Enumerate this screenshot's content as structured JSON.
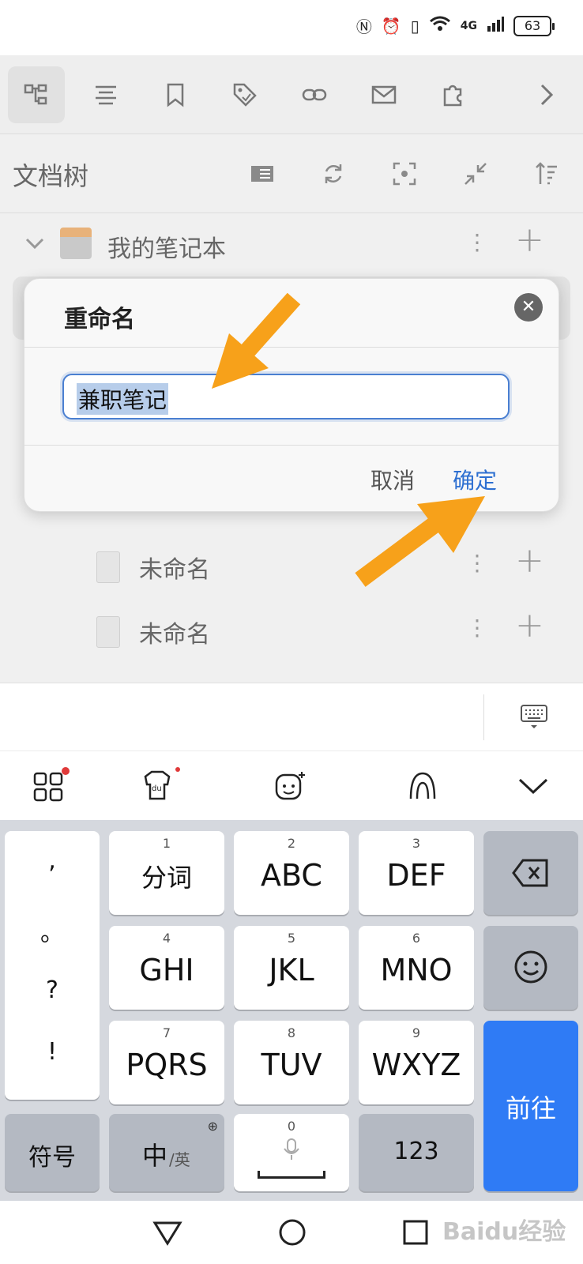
{
  "status_bar": {
    "battery": "63",
    "network": "4G"
  },
  "toolbar": {
    "icons": [
      "tree-icon",
      "outline-icon",
      "bookmark-icon",
      "tag-icon",
      "link-icon",
      "mail-icon",
      "plugin-icon",
      "chevron-right-icon"
    ]
  },
  "tree_header": {
    "title": "文档树"
  },
  "tree": {
    "notebook": "我的笔记本",
    "docs": [
      "未命名",
      "未命名"
    ]
  },
  "dialog": {
    "title": "重命名",
    "input_value": "兼职笔记",
    "cancel_label": "取消",
    "confirm_label": "确定"
  },
  "keyboard": {
    "punct": [
      ",",
      "。",
      "?",
      "!"
    ],
    "keys": [
      {
        "num": "1",
        "label": "分词"
      },
      {
        "num": "2",
        "label": "ABC"
      },
      {
        "num": "3",
        "label": "DEF"
      },
      {
        "num": "4",
        "label": "GHI"
      },
      {
        "num": "5",
        "label": "JKL"
      },
      {
        "num": "6",
        "label": "MNO"
      },
      {
        "num": "7",
        "label": "PQRS"
      },
      {
        "num": "8",
        "label": "TUV"
      },
      {
        "num": "9",
        "label": "WXYZ"
      }
    ],
    "symbols_label": "符号",
    "lang_label": "中",
    "lang_sub": "/英",
    "space_num": "0",
    "numeric_label": "123",
    "go_label": "前往"
  },
  "watermark": "Baidu经验",
  "colors": {
    "accent": "#2d6fd1",
    "go_key": "#2f7bf5",
    "arrow": "#f7a11a"
  }
}
